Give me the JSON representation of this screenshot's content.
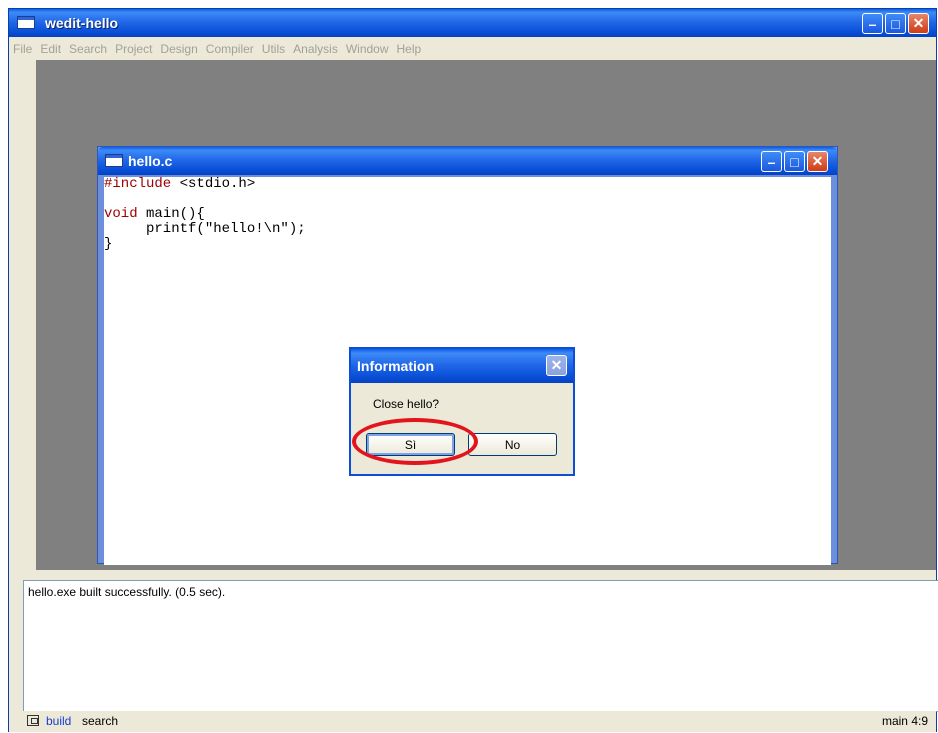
{
  "main_window": {
    "title": "wedit-hello",
    "menu": [
      "File",
      "Edit",
      "Search",
      "Project",
      "Design",
      "Compiler",
      "Utils",
      "Analysis",
      "Window",
      "Help"
    ]
  },
  "editor": {
    "title": "hello.c",
    "code_lines": [
      {
        "kw": "#include",
        "rest": " <stdio.h>"
      },
      {
        "kw": "",
        "rest": ""
      },
      {
        "kw": "void",
        "rest": " main(){"
      },
      {
        "kw": "",
        "rest": "     printf(\"hello!\\n\");"
      },
      {
        "kw": "",
        "rest": "}"
      }
    ]
  },
  "dialog": {
    "title": "Information",
    "message": "Close hello?",
    "yes_label": "Sì",
    "no_label": "No"
  },
  "output": {
    "text": "hello.exe built successfully. (0.5 sec)."
  },
  "statusbar": {
    "tab_build": "build",
    "tab_search": "search",
    "position": "main 4:9"
  },
  "icons": {
    "window_icon": "window-icon",
    "minimize": "minimize-icon",
    "maximize": "maximize-icon",
    "close": "close-icon",
    "pane": "pane-icon"
  },
  "colors": {
    "title_bar": "#2169e8",
    "keyword": "#a00000",
    "highlight_ring": "#e4141c",
    "active_tab": "#1a3ccf"
  }
}
